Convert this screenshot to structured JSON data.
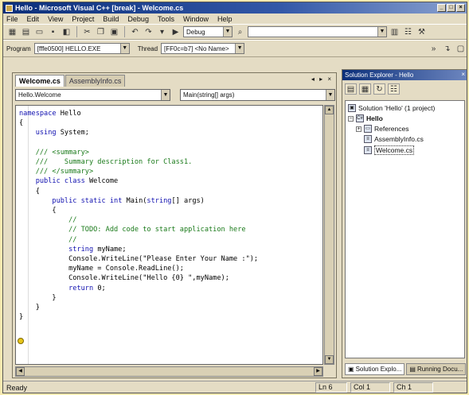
{
  "window": {
    "title": "Hello - Microsoft Visual C++ [break] - Welcome.cs"
  },
  "menu": [
    "File",
    "Edit",
    "View",
    "Project",
    "Build",
    "Debug",
    "Tools",
    "Window",
    "Help"
  ],
  "toolbar": {
    "config_value": "Debug"
  },
  "debug_bar": {
    "program_label": "Program",
    "program_value": "[fffe0500] HELLO.EXE",
    "thread_label": "Thread",
    "thread_value": "[FF0c=b7] <No Name>"
  },
  "editor": {
    "tabs": [
      "Welcome.cs",
      "AssemblyInfo.cs"
    ],
    "tab_controls": "◂ ▸ ×",
    "type_combo": "Hello.Welcome",
    "member_combo": "Main(string[] args)",
    "code_lines": [
      [
        {
          "t": "namespace ",
          "c": "kw"
        },
        {
          "t": "Hello"
        }
      ],
      [
        {
          "t": "{"
        }
      ],
      [
        {
          "t": "    "
        },
        {
          "t": "using ",
          "c": "kw"
        },
        {
          "t": "System;"
        }
      ],
      [
        {
          "t": ""
        }
      ],
      [
        {
          "t": "    /// <summary>",
          "c": "cm"
        }
      ],
      [
        {
          "t": "    ///    Summary description for Class1.",
          "c": "cm"
        }
      ],
      [
        {
          "t": "    /// </summary>",
          "c": "cm"
        }
      ],
      [
        {
          "t": "    "
        },
        {
          "t": "public class ",
          "c": "kw"
        },
        {
          "t": "Welcome"
        }
      ],
      [
        {
          "t": "    {"
        }
      ],
      [
        {
          "t": "        "
        },
        {
          "t": "public static int ",
          "c": "kw"
        },
        {
          "t": "Main("
        },
        {
          "t": "string",
          "c": "kw"
        },
        {
          "t": "[] args)"
        }
      ],
      [
        {
          "t": "        {"
        }
      ],
      [
        {
          "t": "            //",
          "c": "cm"
        }
      ],
      [
        {
          "t": "            // TODO: Add code to start application here",
          "c": "cm"
        }
      ],
      [
        {
          "t": "            //",
          "c": "cm"
        }
      ],
      [
        {
          "t": "            "
        },
        {
          "t": "string ",
          "c": "kw"
        },
        {
          "t": "myName;"
        }
      ],
      [
        {
          "t": "            Console.WriteLine(\"Please Enter Your Name :\");"
        }
      ],
      [
        {
          "t": "            myName = Console.ReadLine();"
        }
      ],
      [
        {
          "t": "            Console.WriteLine(\"Hello {0} \",myName);"
        }
      ],
      [
        {
          "t": "            "
        },
        {
          "t": "return ",
          "c": "kw"
        },
        {
          "t": "0;"
        }
      ],
      [
        {
          "t": "        }"
        }
      ],
      [
        {
          "t": "    }"
        }
      ],
      [
        {
          "t": "}"
        }
      ]
    ]
  },
  "solution_explorer": {
    "title": "Solution Explorer - Hello",
    "nodes": [
      "Solution 'Hello' (1 project)",
      "Hello",
      "References",
      "AssemblyInfo.cs",
      "Welcome.cs"
    ],
    "bottom_tabs": [
      "Solution Explo...",
      "Running Docu..."
    ]
  },
  "status": {
    "ready": "Ready",
    "ln": "Ln 6",
    "col": "Col 1",
    "ch": "Ch 1"
  }
}
